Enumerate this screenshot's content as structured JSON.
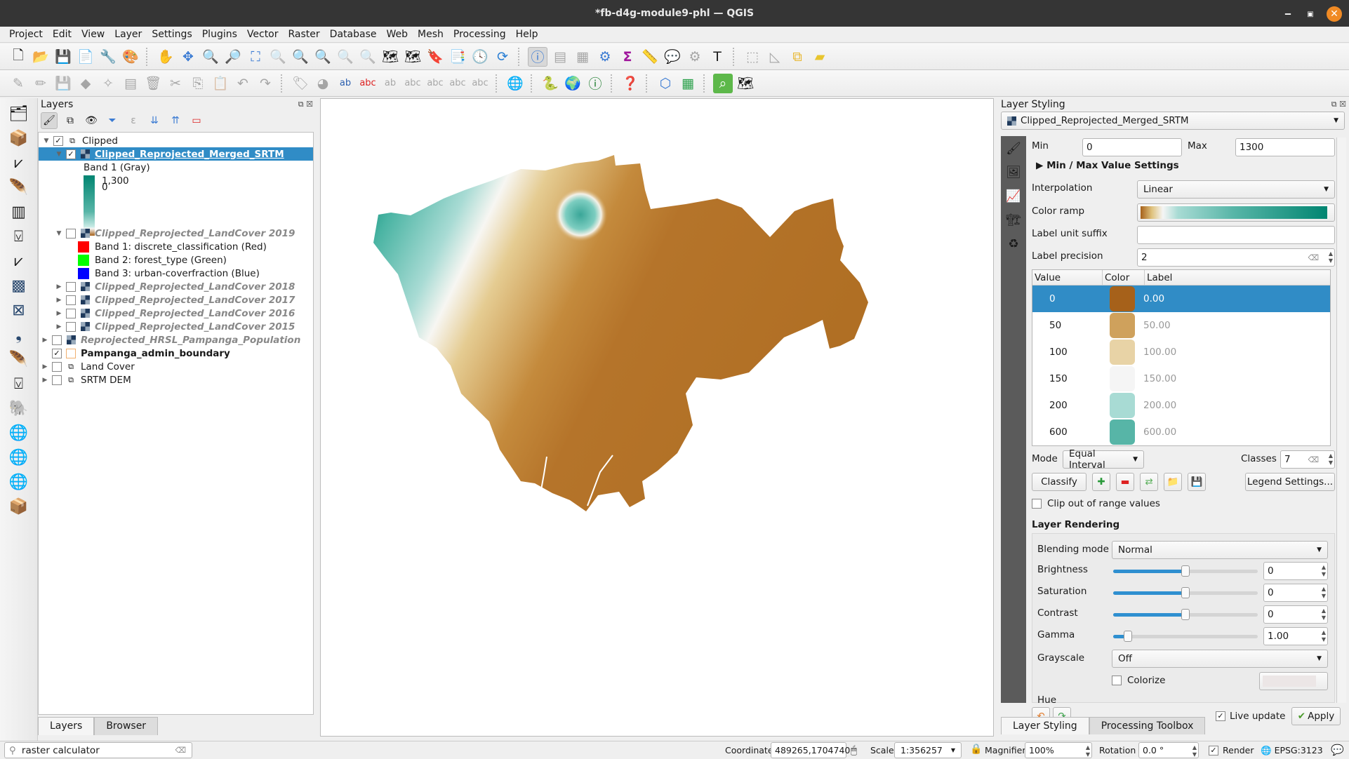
{
  "window": {
    "title": "*fb-d4g-module9-phl — QGIS"
  },
  "menu": [
    "Project",
    "Edit",
    "View",
    "Layer",
    "Settings",
    "Plugins",
    "Vector",
    "Raster",
    "Database",
    "Web",
    "Mesh",
    "Processing",
    "Help"
  ],
  "layers_panel": {
    "title": "Layers",
    "tree": [
      {
        "label": "Clipped",
        "type": "group",
        "checked": true,
        "expanded": true
      },
      {
        "label": "Clipped_Reprojected_Merged_SRTM",
        "type": "raster",
        "checked": true,
        "selected": true
      },
      {
        "label": "Band 1 (Gray)",
        "type": "legend"
      },
      {
        "label": "1,300",
        "type": "ramp-max"
      },
      {
        "label": "0",
        "type": "ramp-min"
      },
      {
        "label": "Clipped_Reprojected_LandCover 2019",
        "type": "raster",
        "checked": false
      },
      {
        "label": "Band 1: discrete_classification (Red)",
        "color": "#ff0000"
      },
      {
        "label": "Band 2: forest_type (Green)",
        "color": "#00ff00"
      },
      {
        "label": "Band 3: urban-coverfraction (Blue)",
        "color": "#0000ff"
      },
      {
        "label": "Clipped_Reprojected_LandCover 2018",
        "checked": false
      },
      {
        "label": "Clipped_Reprojected_LandCover 2017",
        "checked": false
      },
      {
        "label": "Clipped_Reprojected_LandCover 2016",
        "checked": false
      },
      {
        "label": "Clipped_Reprojected_LandCover 2015",
        "checked": false
      },
      {
        "label": "Reprojected_HRSL_Pampanga_Population",
        "checked": false
      },
      {
        "label": "Pampanga_admin_boundary",
        "checked": true
      },
      {
        "label": "Land Cover",
        "type": "group",
        "checked": false
      },
      {
        "label": "SRTM DEM",
        "type": "group",
        "checked": false
      }
    ],
    "tabs": [
      "Layers",
      "Browser"
    ]
  },
  "search": {
    "value": "raster calculator"
  },
  "styling": {
    "title": "Layer Styling",
    "layer": "Clipped_Reprojected_Merged_SRTM",
    "min_label": "Min",
    "min": "0",
    "max_label": "Max",
    "max": "1300",
    "minmax_settings": "Min / Max Value Settings",
    "interpolation_label": "Interpolation",
    "interpolation": "Linear",
    "color_ramp_label": "Color ramp",
    "suffix_label": "Label unit suffix",
    "suffix": "",
    "precision_label": "Label precision",
    "precision": "2",
    "table_headers": [
      "Value",
      "Color",
      "Label"
    ],
    "classes": [
      {
        "value": "0",
        "color": "#a6611a",
        "label": "0.00"
      },
      {
        "value": "50",
        "color": "#cfa15c",
        "label": "50.00"
      },
      {
        "value": "100",
        "color": "#e8d3a6",
        "label": "100.00"
      },
      {
        "value": "150",
        "color": "#f5f5f5",
        "label": "150.00"
      },
      {
        "value": "200",
        "color": "#a8dbd4",
        "label": "200.00"
      },
      {
        "value": "600",
        "color": "#57b5a7",
        "label": "600.00"
      }
    ],
    "mode_label": "Mode",
    "mode": "Equal Interval",
    "classes_label": "Classes",
    "classes_count": "7",
    "classify": "Classify",
    "legend_settings": "Legend Settings...",
    "clip_label": "Clip out of range values",
    "rendering_title": "Layer Rendering",
    "blending_label": "Blending mode",
    "blending": "Normal",
    "brightness_label": "Brightness",
    "brightness": "0",
    "brightness_frac": 0.5,
    "saturation_label": "Saturation",
    "saturation": "0",
    "saturation_frac": 0.5,
    "contrast_label": "Contrast",
    "contrast": "0",
    "contrast_frac": 0.5,
    "gamma_label": "Gamma",
    "gamma": "1.00",
    "gamma_frac": 0.1,
    "grayscale_label": "Grayscale",
    "grayscale": "Off",
    "colorize_label": "Colorize",
    "hue_label": "Hue",
    "live_update": "Live update",
    "apply": "Apply",
    "tabs": [
      "Layer Styling",
      "Processing Toolbox"
    ]
  },
  "status": {
    "coordinate_label": "Coordinate",
    "coordinate": "489265,1704740",
    "scale_label": "Scale",
    "scale": "1:356257",
    "magnifier_label": "Magnifier",
    "magnifier": "100%",
    "rotation_label": "Rotation",
    "rotation": "0.0 °",
    "render_label": "Render",
    "crs": "EPSG:3123"
  }
}
